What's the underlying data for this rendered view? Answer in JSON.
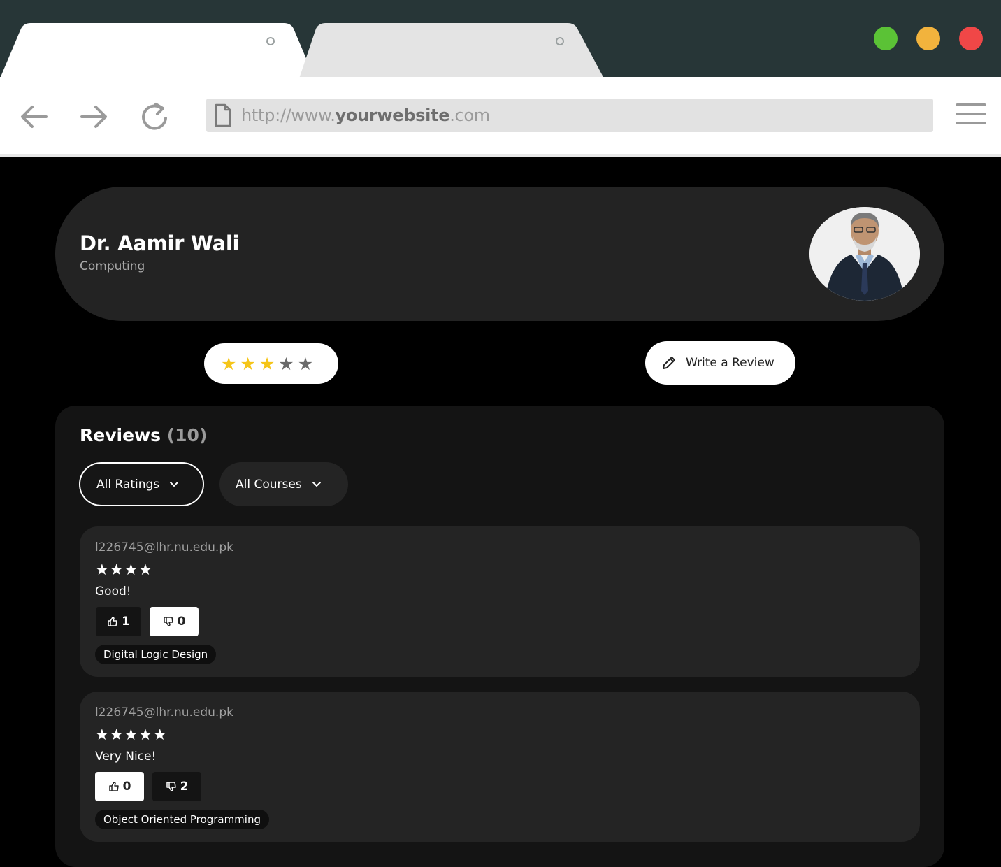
{
  "browser": {
    "url_prefix": "http://www.",
    "url_domain": "yourwebsite",
    "url_suffix": ".com",
    "traffic_colors": {
      "green": "#5bc236",
      "yellow": "#f2b33d",
      "red": "#f04747"
    }
  },
  "profile": {
    "name": "Dr. Aamir Wali",
    "department": "Computing",
    "avatar": "professor-photo"
  },
  "rating": {
    "value": 3,
    "max": 5,
    "star_color": "#f5c518"
  },
  "actions": {
    "write_review_label": "Write a Review"
  },
  "reviews_section": {
    "title": "Reviews",
    "count": "(10)",
    "filters": [
      {
        "label": "All Ratings"
      },
      {
        "label": "All Courses"
      }
    ],
    "items": [
      {
        "email": "l226745@lhr.nu.edu.pk",
        "stars": "★★★★",
        "text": "Good!",
        "likes": "1",
        "dislikes": "0",
        "course": "Digital Logic Design"
      },
      {
        "email": "l226745@lhr.nu.edu.pk",
        "stars": "★★★★★",
        "text": "Very Nice!",
        "likes": "0",
        "dislikes": "2",
        "course": "Object Oriented Programming"
      }
    ]
  }
}
